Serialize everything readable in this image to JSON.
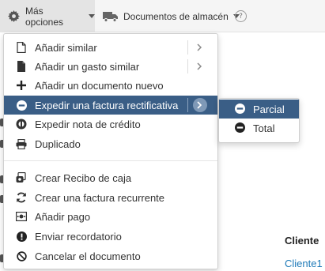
{
  "toolbar": {
    "more_options_label": "Más opciones",
    "warehouse_docs_label": "Documentos de almacén",
    "help_label": "?"
  },
  "background": {
    "client_header": "Cliente",
    "client_link": "Cliente1"
  },
  "menu": {
    "items": [
      {
        "label": "Añadir similar",
        "icon": "file-outline-icon",
        "has_submenu": true
      },
      {
        "label": "Añadir un gasto similar",
        "icon": "file-solid-icon",
        "has_submenu": true
      },
      {
        "label": "Añadir un documento nuevo",
        "icon": "plus-icon",
        "has_submenu": false
      },
      {
        "label": "Expedir una factura rectificativa",
        "icon": "minus-circle-icon",
        "has_submenu": true,
        "active": true
      },
      {
        "label": "Expedir nota de crédito",
        "icon": "credit-note-icon",
        "has_submenu": false
      },
      {
        "label": "Duplicado",
        "icon": "print-icon",
        "has_submenu": false
      },
      {
        "label": "Crear Recibo de caja",
        "icon": "cash-receipt-icon",
        "has_submenu": false
      },
      {
        "label": "Crear una factura recurrente",
        "icon": "refresh-icon",
        "has_submenu": false
      },
      {
        "label": "Añadir pago",
        "icon": "payment-icon",
        "has_submenu": false
      },
      {
        "label": "Enviar recordatorio",
        "icon": "exclamation-circle-icon",
        "has_submenu": false
      },
      {
        "label": "Cancelar el documento",
        "icon": "ban-icon",
        "has_submenu": false
      }
    ]
  },
  "submenu": {
    "items": [
      {
        "label": "Parcial",
        "icon": "minus-circle-icon",
        "active": true
      },
      {
        "label": "Total",
        "icon": "minus-circle-icon",
        "active": false
      }
    ]
  },
  "colors": {
    "active_bg": "#3a5e86",
    "link": "#1e7ab8"
  }
}
